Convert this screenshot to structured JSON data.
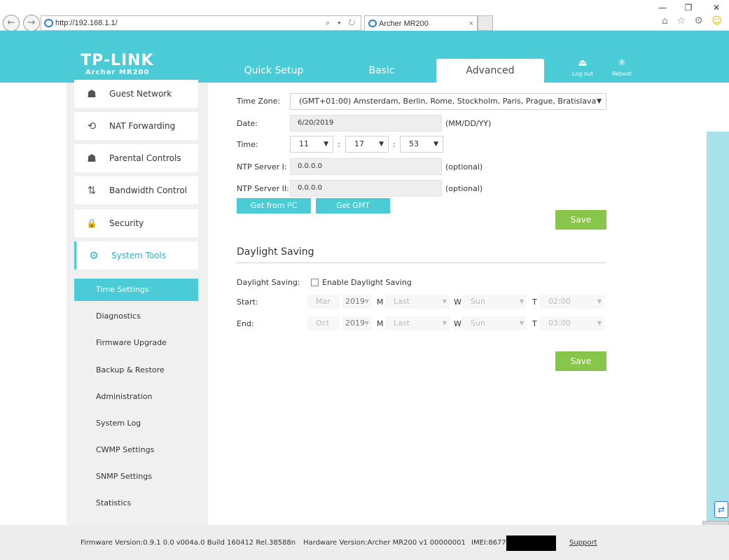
{
  "browser": {
    "url": "http://192.168.1.1/",
    "tab_title": "Archer MR200",
    "url_tools": "⌕ ▾ ↻",
    "minimize": "—",
    "restore": "❐",
    "close": "✕",
    "back_glyph": "←",
    "forward_glyph": "→",
    "tab_close": "×",
    "home_icon": "⌂",
    "star_icon": "☆",
    "gear_icon": "⚙",
    "smiley_icon": "☺"
  },
  "header": {
    "brand": "TP-LINK",
    "model": "Archer MR200",
    "tabs": [
      {
        "label": "Quick Setup",
        "active": false
      },
      {
        "label": "Basic",
        "active": false
      },
      {
        "label": "Advanced",
        "active": true
      }
    ],
    "logout_label": "Log out",
    "reboot_label": "Reboot",
    "logout_icon": "⏏",
    "reboot_icon": "✳"
  },
  "sidebar": {
    "items": [
      {
        "label": "Guest Network",
        "icon": "guest-network-icon",
        "glyph": "☗"
      },
      {
        "label": "NAT Forwarding",
        "icon": "nat-forwarding-icon",
        "glyph": "⟲"
      },
      {
        "label": "Parental Controls",
        "icon": "parental-controls-icon",
        "glyph": "☗"
      },
      {
        "label": "Bandwidth Control",
        "icon": "bandwidth-control-icon",
        "glyph": "⇅"
      },
      {
        "label": "Security",
        "icon": "lock-icon",
        "glyph": "🔒"
      },
      {
        "label": "System Tools",
        "icon": "gear-icon",
        "glyph": "⚙",
        "active": true
      }
    ],
    "sub_items": [
      {
        "label": "Time Settings",
        "active": true
      },
      {
        "label": "Diagnostics"
      },
      {
        "label": "Firmware Upgrade"
      },
      {
        "label": "Backup & Restore"
      },
      {
        "label": "Administration"
      },
      {
        "label": "System Log"
      },
      {
        "label": "CWMP Settings"
      },
      {
        "label": "SNMP Settings"
      },
      {
        "label": "Statistics"
      }
    ]
  },
  "time_settings": {
    "time_zone_label": "Time Zone:",
    "time_zone_value": "(GMT+01:00) Amsterdam, Berlin, Rome, Stockholm, Paris, Prague, Bratislava",
    "date_label": "Date:",
    "date_value": "6/20/2019",
    "date_format": "(MM/DD/YY)",
    "time_label": "Time:",
    "hour": "11",
    "minute": "17",
    "second": "53",
    "colon": ":",
    "ntp1_label": "NTP Server I:",
    "ntp1_value": "0.0.0.0",
    "ntp2_label": "NTP Server II:",
    "ntp2_value": "0.0.0.0",
    "optional": "(optional)",
    "get_from_pc": "Get from PC",
    "get_gmt": "Get GMT",
    "save": "Save"
  },
  "daylight": {
    "title": "Daylight Saving",
    "label": "Daylight Saving:",
    "enable_label": "Enable Daylight Saving",
    "enabled": false,
    "start_label": "Start:",
    "end_label": "End:",
    "m": "M",
    "w": "W",
    "t": "T",
    "start": {
      "month": "Mar",
      "year": "2019",
      "week": "Last",
      "day": "Sun",
      "time": "02:00"
    },
    "end": {
      "month": "Oct",
      "year": "2019",
      "week": "Last",
      "day": "Sun",
      "time": "03:00"
    },
    "save": "Save"
  },
  "footer": {
    "firmware": "Firmware Version:0.9.1 0.0 v004a.0 Build 160412 Rel.38588n",
    "hardware": "Hardware Version:Archer MR200 v1 00000001",
    "imei": "IMEI:8677",
    "support": "Support"
  },
  "colors": {
    "accent": "#4acbd6",
    "save_green": "#88c64b"
  }
}
